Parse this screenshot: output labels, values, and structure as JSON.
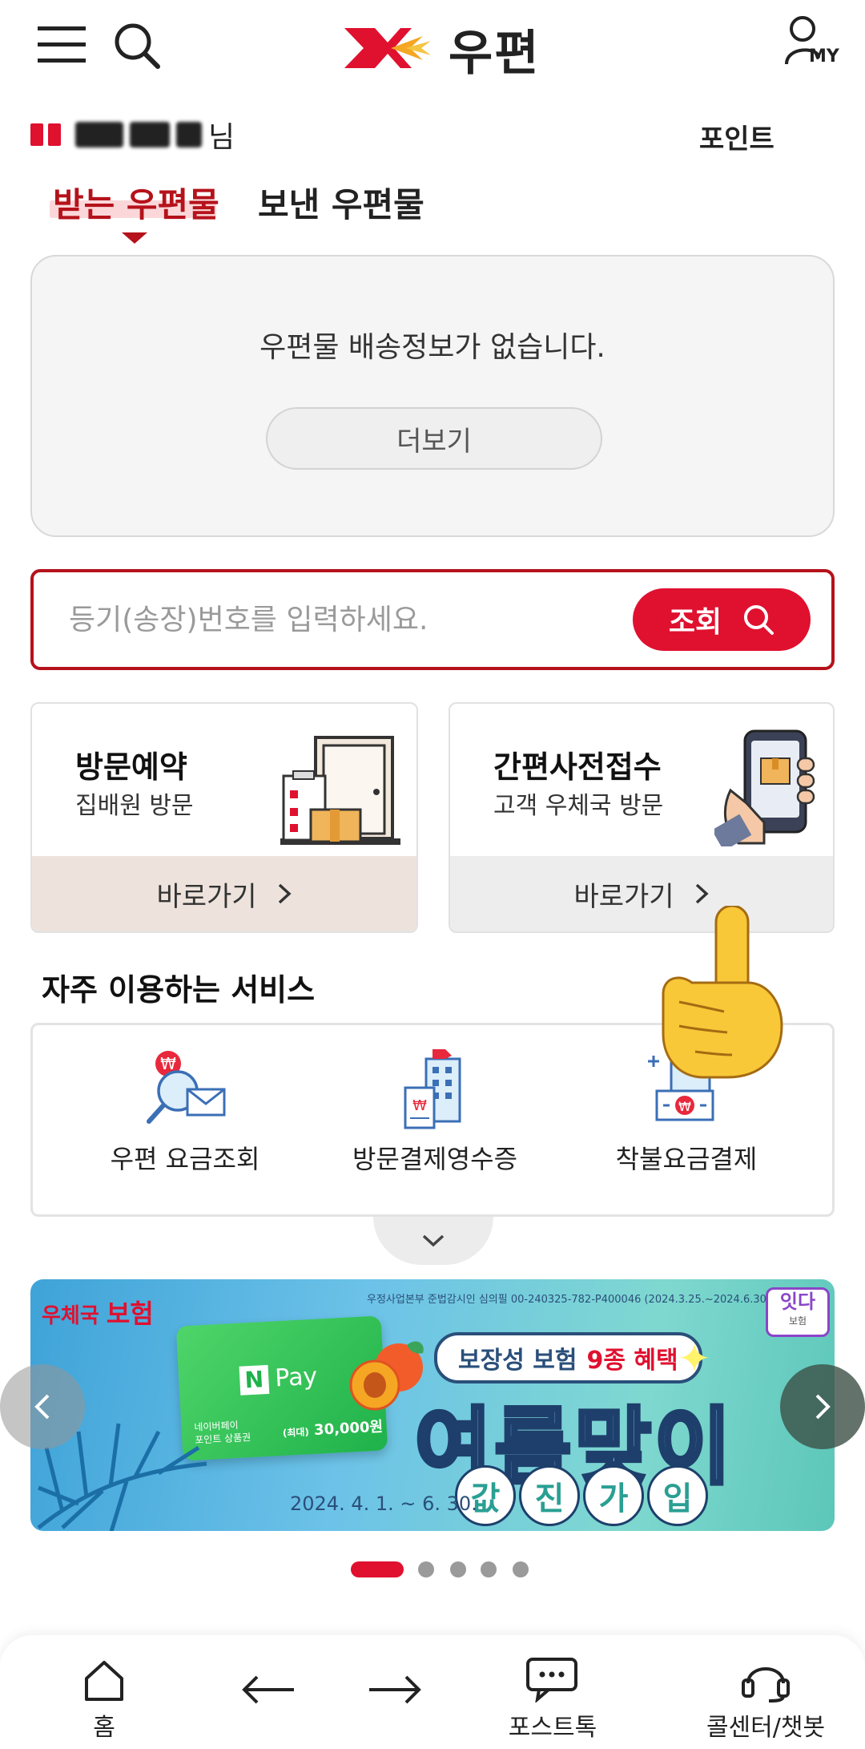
{
  "header": {
    "logo_text": "우편",
    "my_label": "MY"
  },
  "greeting": {
    "suffix": "님",
    "point_label": "포인트"
  },
  "tabs": [
    {
      "label": "받는 우편물",
      "active": true
    },
    {
      "label": "보낸 우편물",
      "active": false
    }
  ],
  "delivery": {
    "empty_message": "우편물 배송정보가 없습니다.",
    "more_label": "더보기"
  },
  "tracking": {
    "placeholder": "등기(송장)번호를 입력하세요.",
    "button_label": "조회"
  },
  "service_cards": [
    {
      "title": "방문예약",
      "subtitle": "집배원 방문",
      "go_label": "바로가기",
      "footer_color": "#ede3dc"
    },
    {
      "title": "간편사전접수",
      "subtitle": "고객 우체국 방문",
      "go_label": "바로가기",
      "footer_color": "#ededee"
    }
  ],
  "frequent": {
    "title": "자주 이용하는 서비스",
    "items": [
      {
        "label": "우편 요금조회",
        "icon": "fee-search-icon"
      },
      {
        "label": "방문결제영수증",
        "icon": "receipt-icon"
      },
      {
        "label": "착불요금결제",
        "icon": "cod-payment-icon"
      }
    ]
  },
  "banner": {
    "brand": "우체국",
    "brand_bold": "보험",
    "notice": "우정사업본부 준법감시인 심의필 00-240325-782-P400046 (2024.3.25.~2024.6.30.)",
    "badge": "잇다",
    "badge_sub": "보험",
    "card_pay": "Pay",
    "card_note1": "네이버페이",
    "card_note2": "포인트 상품권",
    "card_amount_prefix": "(최대)",
    "card_amount": "30,000원",
    "headline_top_a": "보장성 보험",
    "headline_top_b": "9종 혜택",
    "headline_main": "여름맞이",
    "headline_bubbles": [
      "값",
      "진",
      "가",
      "입"
    ],
    "period": "2024. 4. 1. ~ 6. 30.",
    "slide_count": 5,
    "active_slide": 0
  },
  "bottom_nav": [
    {
      "label": "홈",
      "icon": "home-icon"
    },
    {
      "label": "",
      "icon": "back-arrow-icon"
    },
    {
      "label": "",
      "icon": "forward-arrow-icon"
    },
    {
      "label": "포스트톡",
      "icon": "chat-icon"
    },
    {
      "label": "콜센터/챗봇",
      "icon": "headset-icon"
    }
  ],
  "colors": {
    "brand_red": "#e0102f",
    "dark_red": "#b5121b",
    "tab_highlight": "#fbd7d9"
  }
}
